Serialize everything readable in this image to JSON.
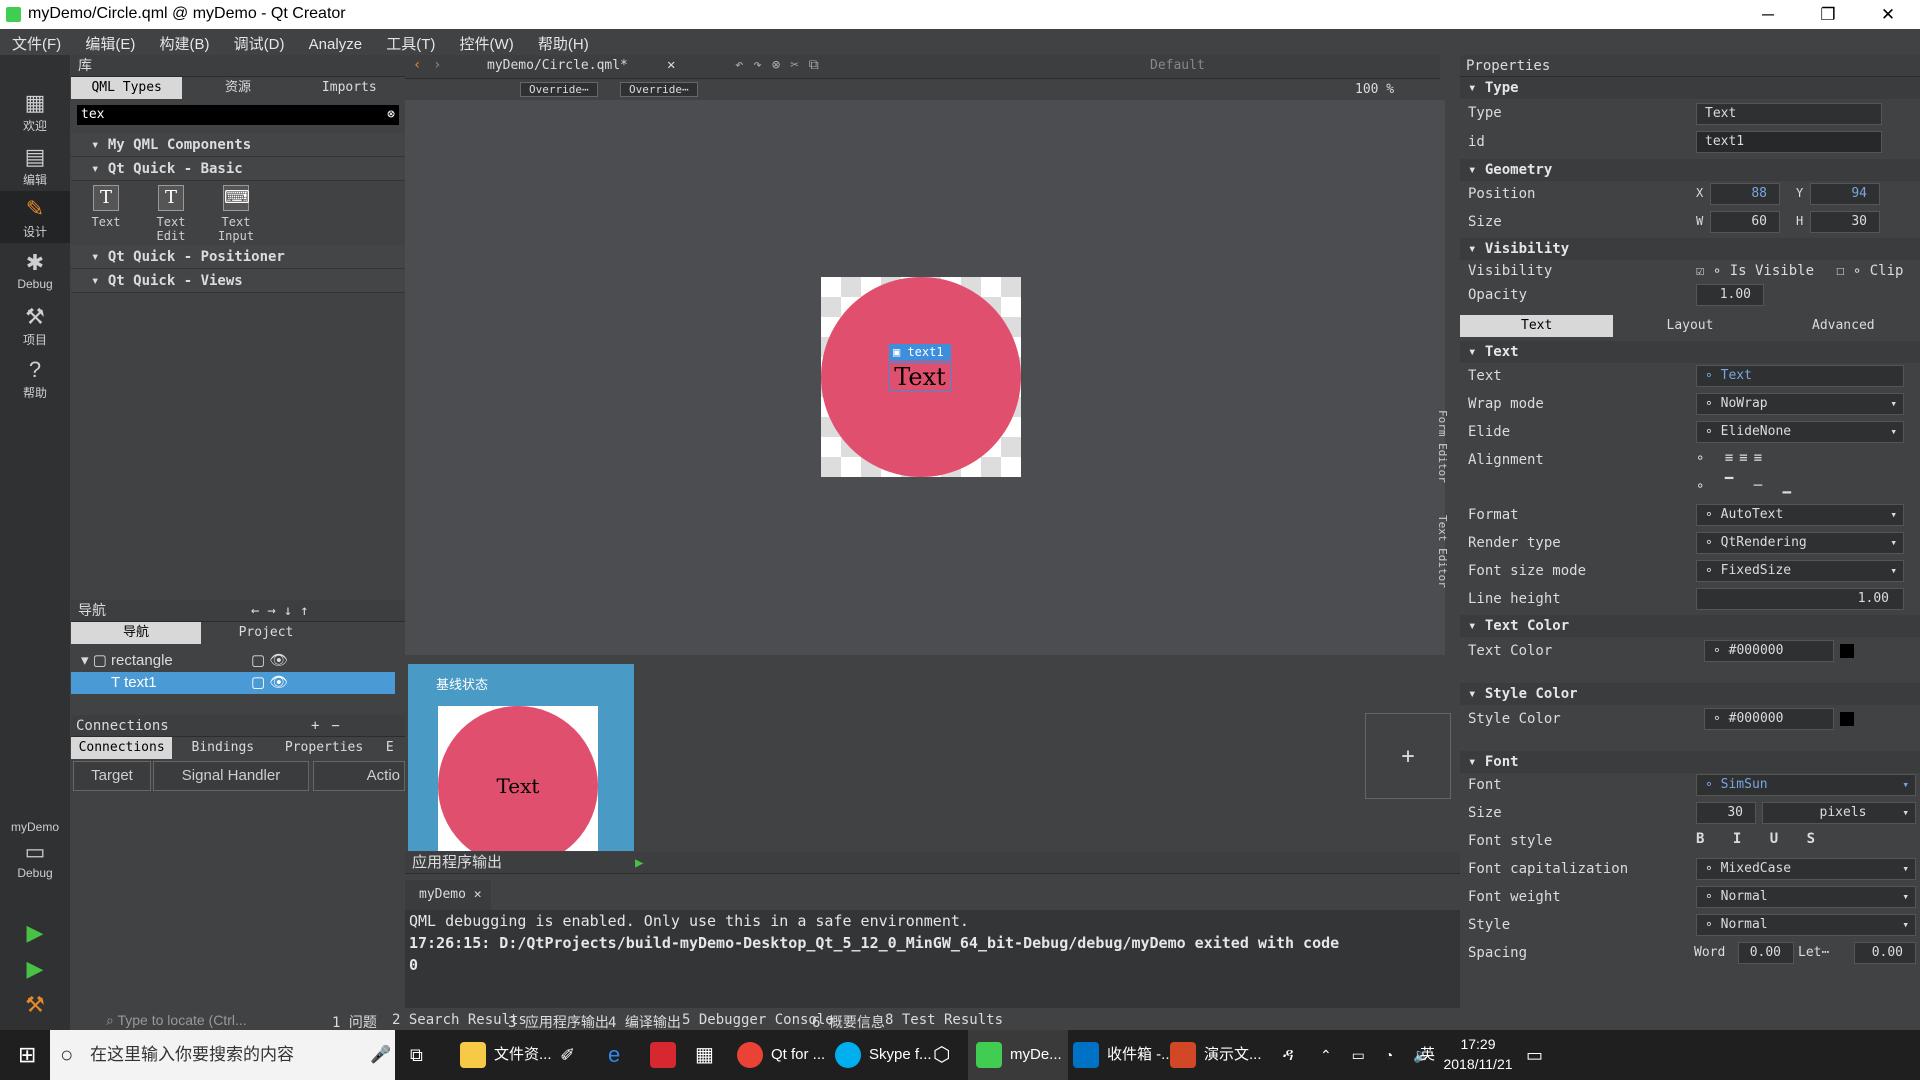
{
  "window": {
    "title": "myDemo/Circle.qml @ myDemo - Qt Creator",
    "minimize": "─",
    "restore": "❐",
    "close": "✕"
  },
  "menu": [
    "文件(F)",
    "编辑(E)",
    "构建(B)",
    "调试(D)",
    "Analyze",
    "工具(T)",
    "控件(W)",
    "帮助(H)"
  ],
  "modes": [
    {
      "label": "欢迎",
      "icon": "grid-icon"
    },
    {
      "label": "编辑",
      "icon": "edit-doc-icon"
    },
    {
      "label": "设计",
      "icon": "pencil-icon"
    },
    {
      "label": "Debug",
      "icon": "bug-icon"
    },
    {
      "label": "项目",
      "icon": "wrench-icon"
    },
    {
      "label": "帮助",
      "icon": "help-icon"
    }
  ],
  "kit": {
    "project": "myDemo",
    "config": "Debug"
  },
  "library": {
    "title": "库",
    "tabs": [
      "QML Types",
      "资源",
      "Imports"
    ],
    "search": "tex",
    "groups": [
      "My QML Components",
      "Qt Quick - Basic",
      "Qt Quick - Positioner",
      "Qt Quick - Views"
    ],
    "items": [
      "Text",
      "Text Edit",
      "Text Input"
    ]
  },
  "navigator": {
    "title": "导航",
    "tabs": [
      "导航",
      "Project"
    ],
    "tree": [
      "rectangle",
      "text1"
    ]
  },
  "connections": {
    "title": "Connections",
    "tabs": [
      "Connections",
      "Bindings",
      "Properties",
      "E"
    ],
    "columns": [
      "Target",
      "Signal Handler",
      "Actio"
    ]
  },
  "editor": {
    "file": "myDemo/Circle.qml*",
    "state": "Default",
    "override1": "Override⋯",
    "override2": "Override⋯",
    "zoom": "100 %",
    "canvas_label": "text1",
    "canvas_text": "Text",
    "side_tabs": [
      "Form Editor",
      "Text Editor"
    ],
    "colors": {
      "circle": "#e0506e",
      "selection": "#3e8ede"
    }
  },
  "states": {
    "base_label": "基线状态",
    "preview_text": "Text",
    "add": "+"
  },
  "output": {
    "title": "应用程序输出",
    "tab": "myDemo",
    "lines": [
      "QML debugging is enabled. Only use this in a safe environment.",
      "17:26:15: D:/QtProjects/build-myDemo-Desktop_Qt_5_12_0_MinGW_64_bit-Debug/debug/myDemo exited with code",
      "0"
    ]
  },
  "statusbar": {
    "locate": "Type to locate (Ctrl...",
    "panes": [
      "1 问题",
      "2 Search Results",
      "3 应用程序输出",
      "4 编译输出",
      "5 Debugger Console",
      "6 概要信息",
      "8 Test Results"
    ]
  },
  "properties": {
    "title": "Properties",
    "type_section": "Type",
    "type_label": "Type",
    "type_value": "Text",
    "id_label": "id",
    "id_value": "text1",
    "geometry_section": "Geometry",
    "position_label": "Position",
    "x_label": "X",
    "x": "88",
    "y_label": "Y",
    "y": "94",
    "size_label": "Size",
    "w_label": "W",
    "w": "60",
    "h_label": "H",
    "h": "30",
    "visibility_section": "Visibility",
    "visibility_label": "Visibility",
    "is_visible": "Is Visible",
    "clip": "Clip",
    "opacity_label": "Opacity",
    "opacity": "1.00",
    "tabs": [
      "Text",
      "Layout",
      "Advanced"
    ],
    "text_section": "Text",
    "text_label": "Text",
    "text_value": "Text",
    "wrap_label": "Wrap mode",
    "wrap": "NoWrap",
    "elide_label": "Elide",
    "elide": "ElideNone",
    "align_label": "Alignment",
    "format_label": "Format",
    "format": "AutoText",
    "render_label": "Render type",
    "render": "QtRendering",
    "fontsize_mode_label": "Font size mode",
    "fontsize_mode": "FixedSize",
    "lineheight_label": "Line height",
    "lineheight": "1.00",
    "textcolor_section": "Text Color",
    "textcolor_label": "Text Color",
    "textcolor": "#000000",
    "stylecolor_section": "Style Color",
    "stylecolor_label": "Style Color",
    "stylecolor": "#000000",
    "font_section": "Font",
    "font_label": "Font",
    "font": "SimSun",
    "size_font_label": "Size",
    "size_font": "30",
    "size_unit": "pixels",
    "fontstyle_label": "Font style",
    "fontcap_label": "Font capitalization",
    "fontcap": "MixedCase",
    "fontweight_label": "Font weight",
    "fontweight": "Normal",
    "style_label": "Style",
    "style": "Normal",
    "spacing_label": "Spacing",
    "word_label": "Word",
    "word": "0.00",
    "letter_label": "Let⋯",
    "letter": "0.00"
  },
  "taskbar": {
    "search": "在这里输入你要搜索的内容",
    "apps": [
      "文件资...",
      "Qt for ...",
      "Skype f...",
      "myDe...",
      "收件箱 -...",
      "演示文..."
    ],
    "time": "17:29",
    "date": "2018/11/21",
    "ime": "英"
  }
}
